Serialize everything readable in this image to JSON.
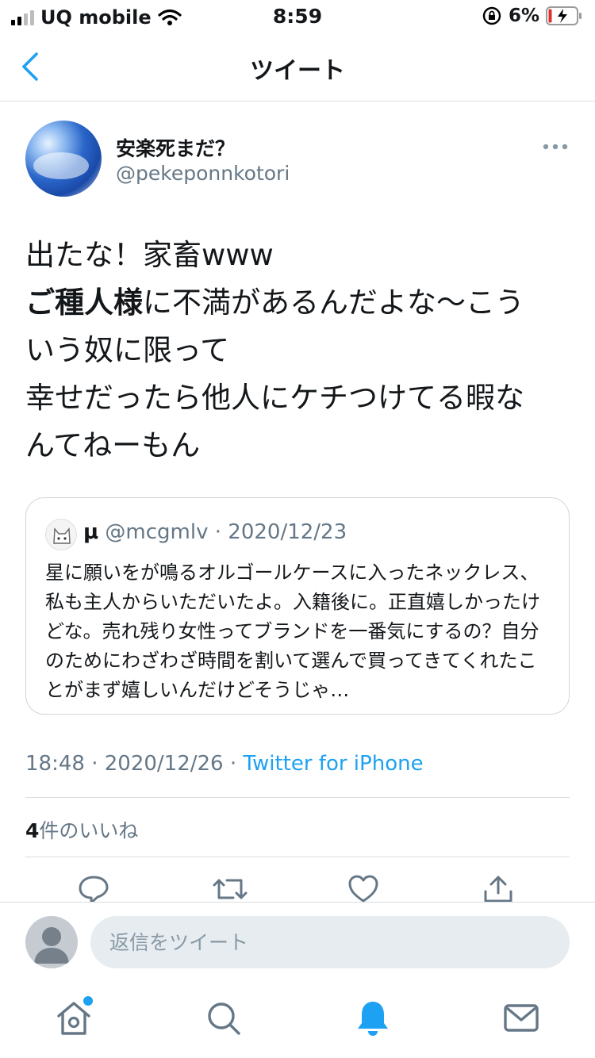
{
  "status_bar": {
    "carrier": "UQ mobile",
    "time": "8:59",
    "battery": "6%"
  },
  "nav": {
    "title": "ツイート"
  },
  "tweet": {
    "author_name": "安楽死まだ？",
    "author_handle": "@pekeponnkotori",
    "lines": {
      "line1": "出たな！家畜www",
      "line2_bold": "ご種人様",
      "line2_rest": "に不満があるんだよな〜こう",
      "line3": "いう奴に限って",
      "line4": "幸せだったら他人にケチつけてる暇な",
      "line5": "んてねーもん"
    },
    "time": "18:48",
    "date": "2020/12/26",
    "source": "Twitter for iPhone",
    "likes_count": "4",
    "likes_label": "件のいいね"
  },
  "quoted": {
    "name": "μ",
    "handle": "@mcgmlv",
    "date": "2020/12/23",
    "text": "星に願いをが鳴るオルゴールケースに入ったネックレス、私も主人からいただいたよ。入籍後に。正直嬉しかったけどな。売れ残り女性ってブランドを一番気にするの？自分のためにわざわざ時間を割いて選んで買ってきてくれたことがまず嬉しいんだけどそうじゃ…"
  },
  "reply": {
    "placeholder": "返信をツイート"
  },
  "colors": {
    "accent": "#1da1f2",
    "secondary_text": "#657786",
    "divider": "#d9dde1"
  },
  "icons": {
    "actions": [
      "comment-icon",
      "retweet-icon",
      "like-icon",
      "share-icon"
    ],
    "tabs": [
      "home-icon",
      "search-icon",
      "notifications-icon",
      "messages-icon"
    ]
  }
}
